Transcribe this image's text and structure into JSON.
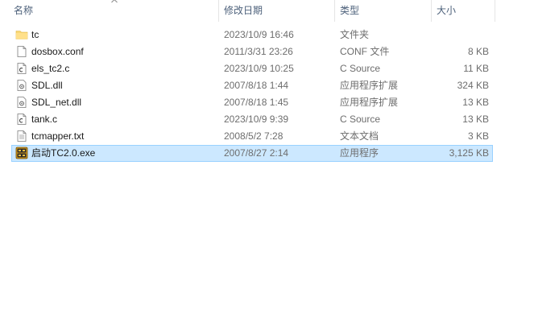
{
  "columns": {
    "name": "名称",
    "date": "修改日期",
    "type": "类型",
    "size": "大小"
  },
  "files": [
    {
      "name": "tc",
      "date": "2023/10/9 16:46",
      "type": "文件夹",
      "size": "",
      "icon": "folder-icon"
    },
    {
      "name": "dosbox.conf",
      "date": "2011/3/31 23:26",
      "type": "CONF 文件",
      "size": "8 KB",
      "icon": "text-file-icon"
    },
    {
      "name": "els_tc2.c",
      "date": "2023/10/9 10:25",
      "type": "C Source",
      "size": "11 KB",
      "icon": "c-source-file-icon"
    },
    {
      "name": "SDL.dll",
      "date": "2007/8/18 1:44",
      "type": "应用程序扩展",
      "size": "324 KB",
      "icon": "dll-file-icon"
    },
    {
      "name": "SDL_net.dll",
      "date": "2007/8/18 1:45",
      "type": "应用程序扩展",
      "size": "13 KB",
      "icon": "dll-file-icon"
    },
    {
      "name": "tank.c",
      "date": "2023/10/9 9:39",
      "type": "C Source",
      "size": "13 KB",
      "icon": "c-source-file-icon"
    },
    {
      "name": "tcmapper.txt",
      "date": "2008/5/2 7:28",
      "type": "文本文档",
      "size": "3 KB",
      "icon": "text-file-icon"
    },
    {
      "name": "启动TC2.0.exe",
      "date": "2007/8/27 2:14",
      "type": "应用程序",
      "size": "3,125 KB",
      "icon": "dosbox-exe-icon"
    }
  ],
  "selected_file": "启动TC2.0.exe",
  "colors": {
    "selection_bg": "#cce8ff",
    "selection_border": "#99d1ff",
    "header_text": "#4c607a",
    "folder": "#f8d775"
  }
}
